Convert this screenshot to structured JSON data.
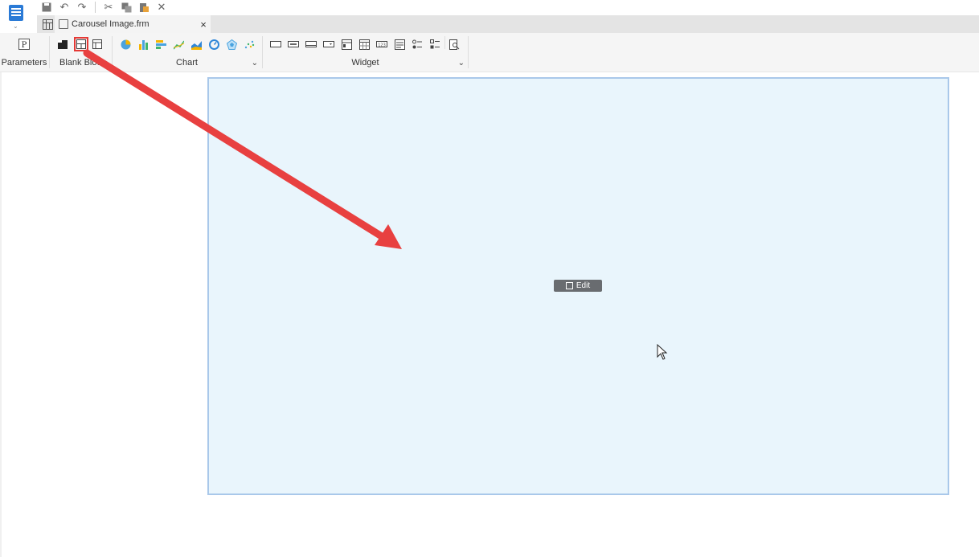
{
  "document_tab": {
    "title": "Carousel Image.frm",
    "close_glyph": "×"
  },
  "ribbon": {
    "groups": [
      {
        "label": "Parameters"
      },
      {
        "label": "Blank Block"
      },
      {
        "label": "Chart"
      },
      {
        "label": "Widget"
      }
    ],
    "parameters_icon_text": "P",
    "blank_block_icons": [
      "dark-block-icon",
      "absolute-block-icon",
      "tab-block-icon"
    ],
    "chart_icons": [
      "pie-chart-icon",
      "column-chart-icon",
      "bar-chart-icon",
      "line-chart-icon",
      "area-chart-icon",
      "gauge-chart-icon",
      "radar-chart-icon",
      "scatter-chart-icon"
    ],
    "widget_icons": [
      "label-widget-icon",
      "text-widget-icon",
      "button-widget-icon",
      "combo-widget-icon",
      "date-widget-icon",
      "calendar-widget-icon",
      "number-widget-icon",
      "list-widget-icon",
      "radio-group-icon",
      "checkbox-group-icon",
      "preview-icon"
    ]
  },
  "canvas": {
    "edit_label": "Edit"
  },
  "colors": {
    "accent": "#2a7ad6",
    "annotation_arrow": "#e84040",
    "block_fill": "#e9f5fc",
    "block_border": "#a9c8ea"
  }
}
